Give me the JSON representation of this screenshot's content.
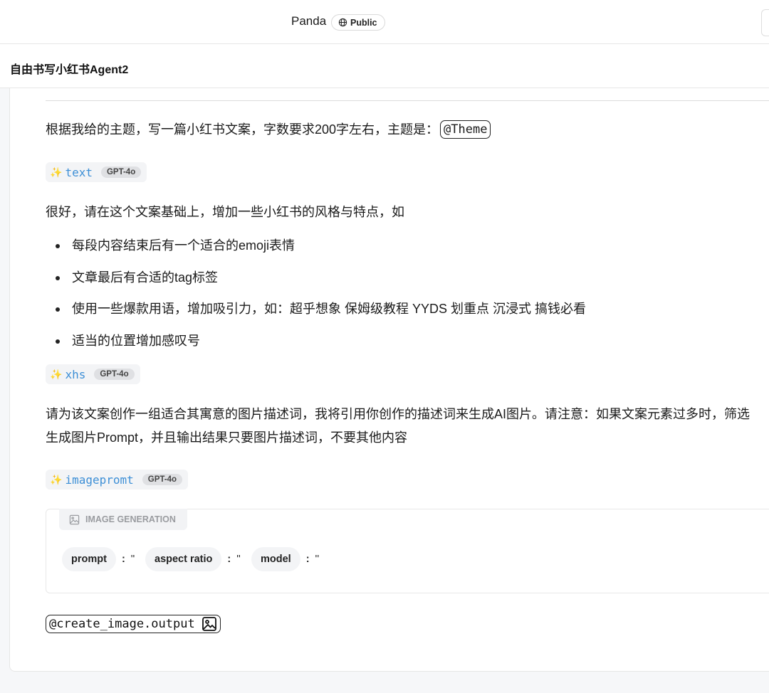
{
  "header": {
    "app_name": "Panda",
    "visibility": "Public"
  },
  "doc": {
    "title": "自由书写小红书Agent2"
  },
  "blocks": {
    "prompt1_text": "根据我给的主题，写一篇小红书文案，字数要求200字左右，主题是：",
    "prompt1_mention": "@Theme",
    "chip1": {
      "var": "text",
      "model": "GPT-4o"
    },
    "prompt2_text": "很好，请在这个文案基础上，增加一些小红书的风格与特点，如",
    "bullets": [
      "每段内容结束后有一个适合的emoji表情",
      "文章最后有合适的tag标签",
      "使用一些爆款用语，增加吸引力，如：超乎想象 保姆级教程 YYDS 划重点 沉浸式 搞钱必看",
      "适当的位置增加感叹号"
    ],
    "chip2": {
      "var": "xhs",
      "model": "GPT-4o"
    },
    "prompt3_line1": "请为该文案创作一组适合其寓意的图片描述词，我将引用你创作的描述词来生成AI图片。请注意：如果文案元素过多时，筛选",
    "prompt3_line2": "生成图片Prompt，并且输出结果只要图片描述词，不要其他内容",
    "chip3": {
      "var": "imagepromt",
      "model": "GPT-4o"
    }
  },
  "image_generation": {
    "label": "IMAGE GENERATION",
    "params": [
      {
        "name": "prompt",
        "sep": ":",
        "value": "''"
      },
      {
        "name": "aspect ratio",
        "sep": ":",
        "value": "''"
      },
      {
        "name": "model",
        "sep": ":",
        "value": "''"
      }
    ]
  },
  "output": {
    "mention": "@create_image.output"
  },
  "icons": {
    "spark": "sparkles-icon",
    "globe": "globe-icon",
    "image": "image-icon"
  }
}
